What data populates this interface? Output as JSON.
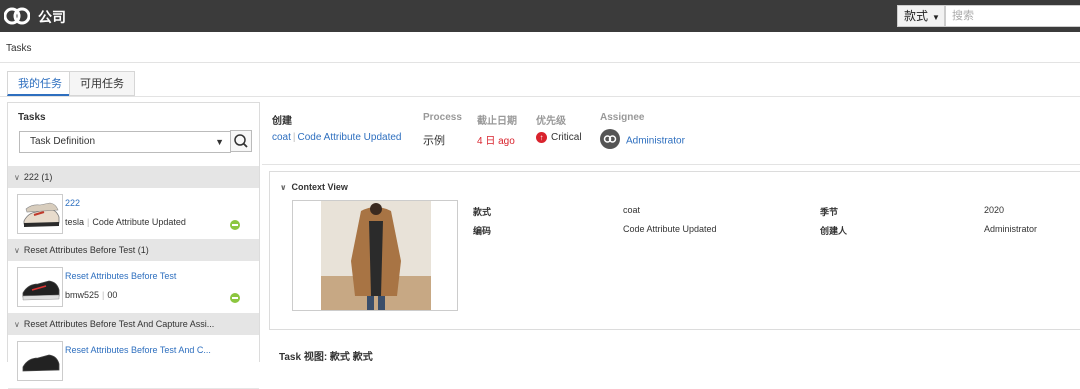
{
  "topbar": {
    "company": "公司",
    "style_dropdown": "款式",
    "search_placeholder": "搜索"
  },
  "breadcrumb": "Tasks",
  "tabs": [
    {
      "label": "我的任务",
      "active": true
    },
    {
      "label": "可用任务",
      "active": false
    }
  ],
  "left_panel": {
    "title": "Tasks",
    "filter": "Task Definition",
    "groups": [
      {
        "header": "222 (1)",
        "item": {
          "link": "222",
          "sub_a": "tesla",
          "sub_b": "Code Attribute Updated"
        }
      },
      {
        "header": "Reset Attributes Before Test (1)",
        "item": {
          "link": "Reset Attributes Before Test",
          "sub_a": "bmw525",
          "sub_b": "00"
        }
      },
      {
        "header": "Reset Attributes Before Test And Capture Assi...",
        "item": {
          "link": "Reset Attributes Before Test And C..."
        }
      }
    ]
  },
  "detail_header": {
    "labels": {
      "create": "创建",
      "process": "Process",
      "due": "截止日期",
      "priority": "优先级",
      "assignee": "Assignee"
    },
    "values": {
      "create_a": "coat",
      "create_b": "Code Attribute Updated",
      "process": "示例",
      "due": "4 日 ago",
      "priority": "Critical",
      "assignee": "Administrator"
    }
  },
  "context_view": {
    "title": "Context View",
    "fields": [
      {
        "label": "款式",
        "value": "coat"
      },
      {
        "label": "编码",
        "value": "Code Attribute Updated"
      },
      {
        "label": "季节",
        "value": "2020"
      },
      {
        "label": "创建人",
        "value": "Administrator"
      }
    ]
  },
  "footer_title": "Task 视图: 款式 款式",
  "colors": {
    "accent": "#2e6fbf",
    "critical": "#d9232d",
    "status_ok": "#8cc63f",
    "topbar": "#3b3b3b"
  }
}
